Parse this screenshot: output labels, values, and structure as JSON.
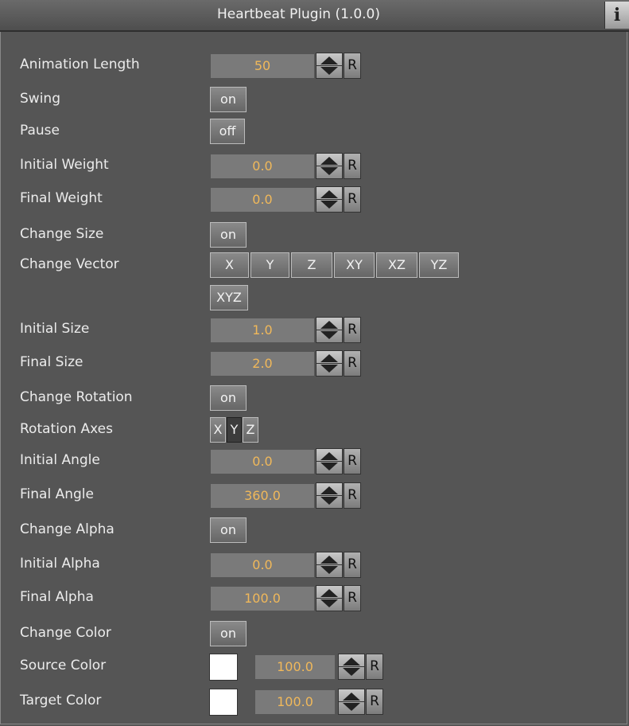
{
  "window": {
    "title": "Heartbeat Plugin (1.0.0)",
    "info_label": "i"
  },
  "animation_length": {
    "label": "Animation Length",
    "value": "50"
  },
  "swing": {
    "label": "Swing",
    "value": "on"
  },
  "pause": {
    "label": "Pause",
    "value": "off"
  },
  "initial_weight": {
    "label": "Initial Weight",
    "value": "0.0"
  },
  "final_weight": {
    "label": "Final Weight",
    "value": "0.0"
  },
  "change_size": {
    "label": "Change Size",
    "value": "on"
  },
  "change_vector": {
    "label": "Change Vector",
    "options": [
      "X",
      "Y",
      "Z",
      "XY",
      "XZ",
      "YZ",
      "XYZ"
    ]
  },
  "initial_size": {
    "label": "Initial Size",
    "value": "1.0"
  },
  "final_size": {
    "label": "Final Size",
    "value": "2.0"
  },
  "change_rotation": {
    "label": "Change Rotation",
    "value": "on"
  },
  "rotation_axes": {
    "label": "Rotation Axes",
    "options": [
      "X",
      "Y",
      "Z"
    ],
    "selected": "Y"
  },
  "initial_angle": {
    "label": "Initial Angle",
    "value": "0.0"
  },
  "final_angle": {
    "label": "Final Angle",
    "value": "360.0"
  },
  "change_alpha": {
    "label": "Change Alpha",
    "value": "on"
  },
  "initial_alpha": {
    "label": "Initial Alpha",
    "value": "0.0"
  },
  "final_alpha": {
    "label": "Final Alpha",
    "value": "100.0"
  },
  "change_color": {
    "label": "Change Color",
    "value": "on"
  },
  "source_color": {
    "label": "Source Color",
    "color": "#ffffff",
    "alpha": "100.0"
  },
  "target_color": {
    "label": "Target Color",
    "color": "#ffffff",
    "alpha": "100.0"
  },
  "reset_label": "R",
  "colors": {
    "background": "#555555",
    "field": "#7a7a7a",
    "value_text": "#f0b85a"
  }
}
